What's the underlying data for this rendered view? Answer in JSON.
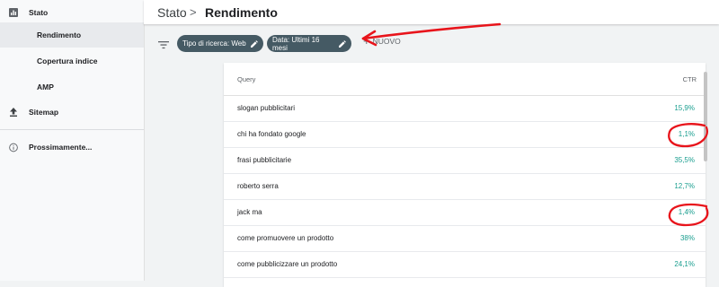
{
  "sidebar": {
    "items": [
      {
        "label": "Stato",
        "icon": "bar-chart-icon"
      },
      {
        "label": "Rendimento"
      },
      {
        "label": "Copertura indice"
      },
      {
        "label": "AMP"
      },
      {
        "label": "Sitemap",
        "icon": "upload-icon"
      },
      {
        "label": "Prossimamente...",
        "icon": "info-icon"
      }
    ]
  },
  "header": {
    "section": "Stato",
    "separator": ">",
    "title": "Rendimento"
  },
  "filters": {
    "chips": [
      {
        "label": "Tipo di ricerca: Web"
      },
      {
        "label": "Data: Ultimi 16 mesi"
      }
    ],
    "add_label": "NUOVO"
  },
  "table": {
    "columns": {
      "query": "Query",
      "ctr": "CTR"
    },
    "rows": [
      {
        "query": "slogan pubblicitari",
        "ctr": "15,9%"
      },
      {
        "query": "chi ha fondato google",
        "ctr": "1,1%"
      },
      {
        "query": "frasi pubblicitarie",
        "ctr": "35,5%"
      },
      {
        "query": "roberto serra",
        "ctr": "12,7%"
      },
      {
        "query": "jack ma",
        "ctr": "1,4%"
      },
      {
        "query": "come promuovere un prodotto",
        "ctr": "38%"
      },
      {
        "query": "come pubblicizzare un prodotto",
        "ctr": "24,1%"
      }
    ]
  },
  "colors": {
    "chip_bg": "#455a64",
    "ctr_text": "#1a9e8f",
    "annotation_red": "#e8141b"
  }
}
